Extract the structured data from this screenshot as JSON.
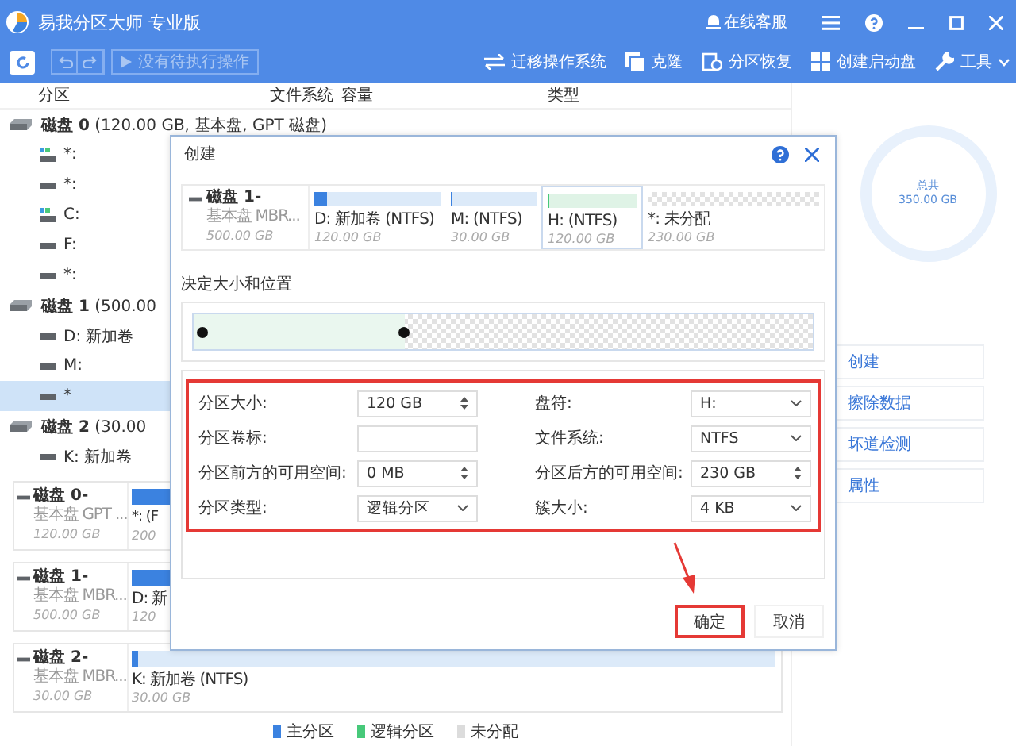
{
  "window": {
    "title": "易我分区大师 专业版",
    "support": "在线客服"
  },
  "toolbar": {
    "pending": "没有待执行操作",
    "actions": [
      {
        "label": "迁移操作系统",
        "kind": "migrate"
      },
      {
        "label": "克隆",
        "kind": "clone"
      },
      {
        "label": "分区恢复",
        "kind": "recover"
      },
      {
        "label": "创建启动盘",
        "kind": "boot"
      },
      {
        "label": "工具",
        "kind": "tools"
      }
    ]
  },
  "table": {
    "columns": [
      "分区",
      "文件系统",
      "容量",
      "类型"
    ],
    "disks": [
      {
        "label": "**磁盘 0** (120.00 GB, 基本盘, GPT 磁盘)",
        "children": [
          {
            "label": "*:",
            "kind": "system",
            "selected": false
          },
          {
            "label": "*:",
            "kind": "drive",
            "selected": false
          },
          {
            "label": "C:",
            "kind": "system",
            "selected": false
          },
          {
            "label": "F:",
            "kind": "drive",
            "selected": false
          },
          {
            "label": "*:",
            "kind": "drive",
            "selected": false
          }
        ]
      },
      {
        "label": "**磁盘 1** (500.00",
        "children": [
          {
            "label": "D: 新加卷",
            "kind": "drive",
            "selected": false
          },
          {
            "label": "M:",
            "kind": "drive",
            "selected": false
          },
          {
            "label": "*",
            "kind": "drive",
            "selected": true
          }
        ]
      },
      {
        "label": "**磁盘 2** (30.00",
        "children": [
          {
            "label": "K: 新加卷",
            "kind": "drive",
            "selected": false
          }
        ]
      }
    ]
  },
  "disk_cards": [
    {
      "name": "磁盘 0-",
      "type": "基本盘 GPT ...",
      "size": "120.00 GB",
      "partition": {
        "label": "*: (F",
        "size": "200",
        "level": 0.12
      }
    },
    {
      "name": "磁盘 1-",
      "type": "基本盘 MBR...",
      "size": "500.00 GB",
      "partition": {
        "label": "D: 新",
        "size": "120",
        "level": 0.12
      }
    },
    {
      "name": "磁盘 2-",
      "type": "基本盘 MBR...",
      "size": "30.00 GB",
      "partition": {
        "label": "K: 新加卷 (NTFS)",
        "size": "30.00 GB",
        "level": 0.01
      }
    }
  ],
  "legend": [
    {
      "label": "主分区",
      "color": "#3b82e0"
    },
    {
      "label": "逻辑分区",
      "color": "#47c97a"
    },
    {
      "label": "未分配",
      "color": "#dcdcdc"
    }
  ],
  "summary": {
    "label": "总共",
    "value": "350.00 GB"
  },
  "actions": [
    "创建",
    "擦除数据",
    "坏道检测",
    "属性"
  ],
  "dialog": {
    "title": "创建",
    "disk": {
      "name": "磁盘 1-",
      "type": "基本盘 MBR...",
      "size": "500.00 GB"
    },
    "partitions": [
      {
        "label": "D: 新加卷 (NTFS)",
        "size": "120.00 GB",
        "kind": "primary",
        "level": 0.1,
        "selected": false
      },
      {
        "label": "M:  (NTFS)",
        "size": "30.00 GB",
        "kind": "primary",
        "level": 0.02,
        "selected": false
      },
      {
        "label": "H:  (NTFS)",
        "size": "120.00 GB",
        "kind": "logical",
        "level": 0.01,
        "selected": true
      },
      {
        "label": "*: 未分配",
        "size": "230.00 GB",
        "kind": "unallocated",
        "selected": false
      }
    ],
    "section": "决定大小和位置",
    "slider": {
      "level": 0.34
    },
    "fields": [
      {
        "label": "分区大小:",
        "value": "120 GB",
        "kind": "spin"
      },
      {
        "label": "盘符:",
        "value": "H:",
        "kind": "select"
      },
      {
        "label": "分区卷标:",
        "kind": "text"
      },
      {
        "label": "文件系统:",
        "value": "NTFS",
        "kind": "select"
      },
      {
        "label": "分区前方的可用空间:",
        "value": "0 MB",
        "kind": "spin"
      },
      {
        "label": "分区后方的可用空间:",
        "value": "230 GB",
        "kind": "spin"
      },
      {
        "label": "分区类型:",
        "value": "逻辑分区",
        "kind": "select"
      },
      {
        "label": "簇大小:",
        "value": "4 KB",
        "kind": "select"
      }
    ],
    "buttons": [
      {
        "label": "确定",
        "highlighted": true
      },
      {
        "label": "取消",
        "highlighted": false
      }
    ]
  }
}
